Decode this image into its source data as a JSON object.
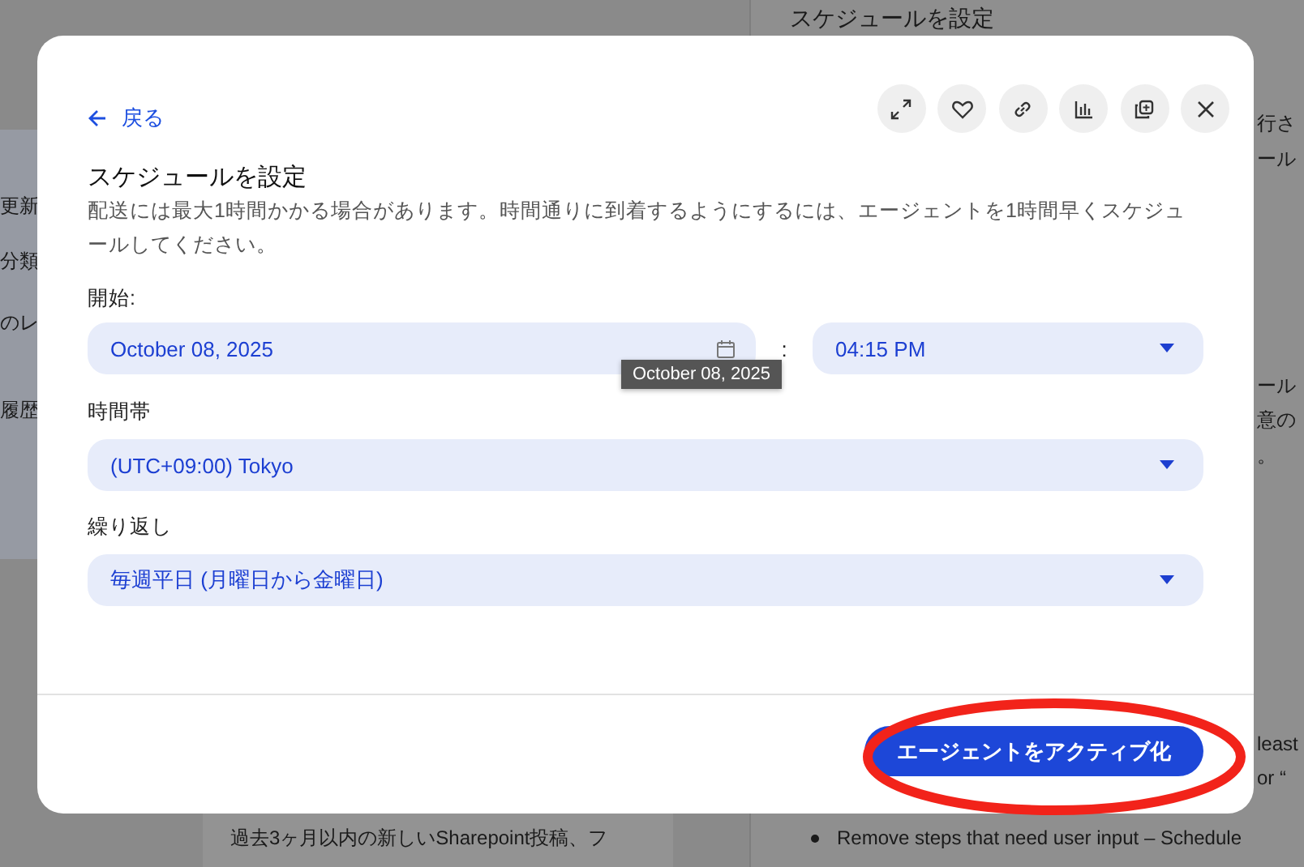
{
  "background": {
    "left_fragments": [
      "更新",
      "分類",
      "のレ",
      "履歴"
    ],
    "right_panel": {
      "title": "スケジュールを設定",
      "fragments": [
        "行さ",
        "ール",
        "ール",
        "意の",
        "。",
        "least",
        "or “"
      ],
      "bullet": "Remove steps that need user input – Schedule"
    },
    "center_panel": {
      "text": "過去3ヶ月以内の新しいSharepoint投稿、フ"
    }
  },
  "dialog": {
    "back_label": "戻る",
    "title": "スケジュールを設定",
    "description": "配送には最大1時間かかる場合があります。時間通りに到着するようにするには、エージェントを1時間早くスケジュールしてください。",
    "start": {
      "label": "開始:",
      "date": "October 08, 2025",
      "separator": ":",
      "time": "04:15 PM",
      "tooltip": "October 08, 2025"
    },
    "timezone": {
      "label": "時間帯",
      "value": "(UTC+09:00) Tokyo"
    },
    "repeat": {
      "label": "繰り返し",
      "value": "毎週平日 (月曜日から金曜日)"
    },
    "primary_button": {
      "label": "エージェントをアクティブ化",
      "highlighted": true
    }
  }
}
